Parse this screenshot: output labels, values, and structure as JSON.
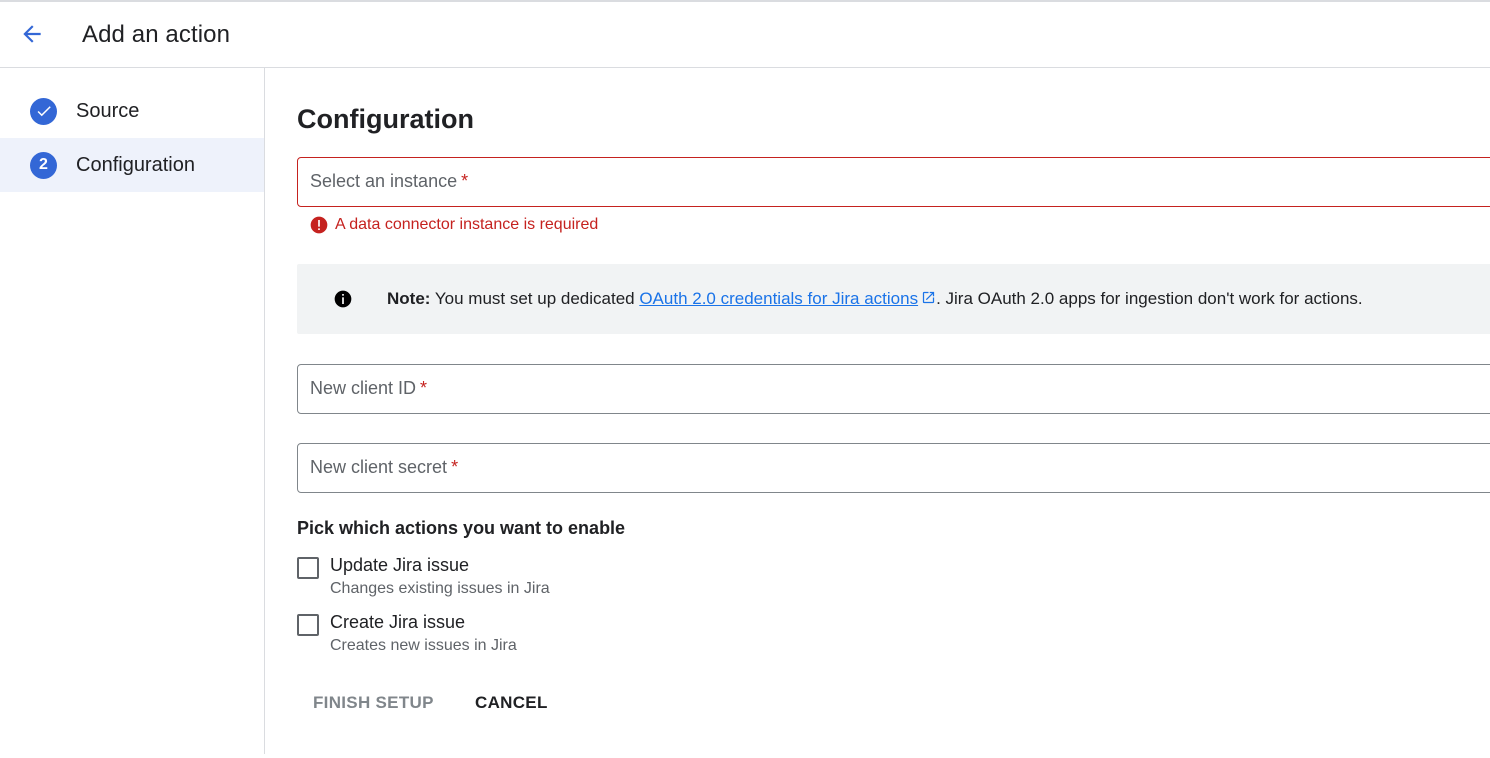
{
  "header": {
    "title": "Add an action",
    "back_icon": "arrow-back-icon"
  },
  "sidebar": {
    "steps": [
      {
        "label": "Source",
        "status": "completed",
        "icon": "check-circle-icon"
      },
      {
        "label": "Configuration",
        "status": "active",
        "number": "2"
      }
    ]
  },
  "main": {
    "title": "Configuration",
    "instance_field": {
      "label": "Select an instance",
      "required_mark": "*",
      "value": "",
      "error": "A data connector instance is required"
    },
    "note": {
      "prefix": "Note:",
      "text_before": " You must set up dedicated ",
      "link_text": "OAuth 2.0 credentials for Jira actions",
      "text_after": ". Jira OAuth 2.0 apps for ingestion don't work for actions."
    },
    "client_id_field": {
      "label": "New client ID",
      "required_mark": "*",
      "value": ""
    },
    "client_secret_field": {
      "label": "New client secret",
      "required_mark": "*",
      "value": ""
    },
    "actions": {
      "title": "Pick which actions you want to enable",
      "options": [
        {
          "label": "Update Jira issue",
          "description": "Changes existing issues in Jira",
          "checked": false
        },
        {
          "label": "Create Jira issue",
          "description": "Creates new issues in Jira",
          "checked": false
        }
      ]
    },
    "buttons": {
      "finish": "FINISH SETUP",
      "cancel": "CANCEL"
    }
  },
  "colors": {
    "accent": "#3367d6",
    "error": "#c5221f",
    "link": "#1a73e8",
    "active_step_bg": "#eef2fb",
    "note_bg": "#f1f3f4"
  }
}
